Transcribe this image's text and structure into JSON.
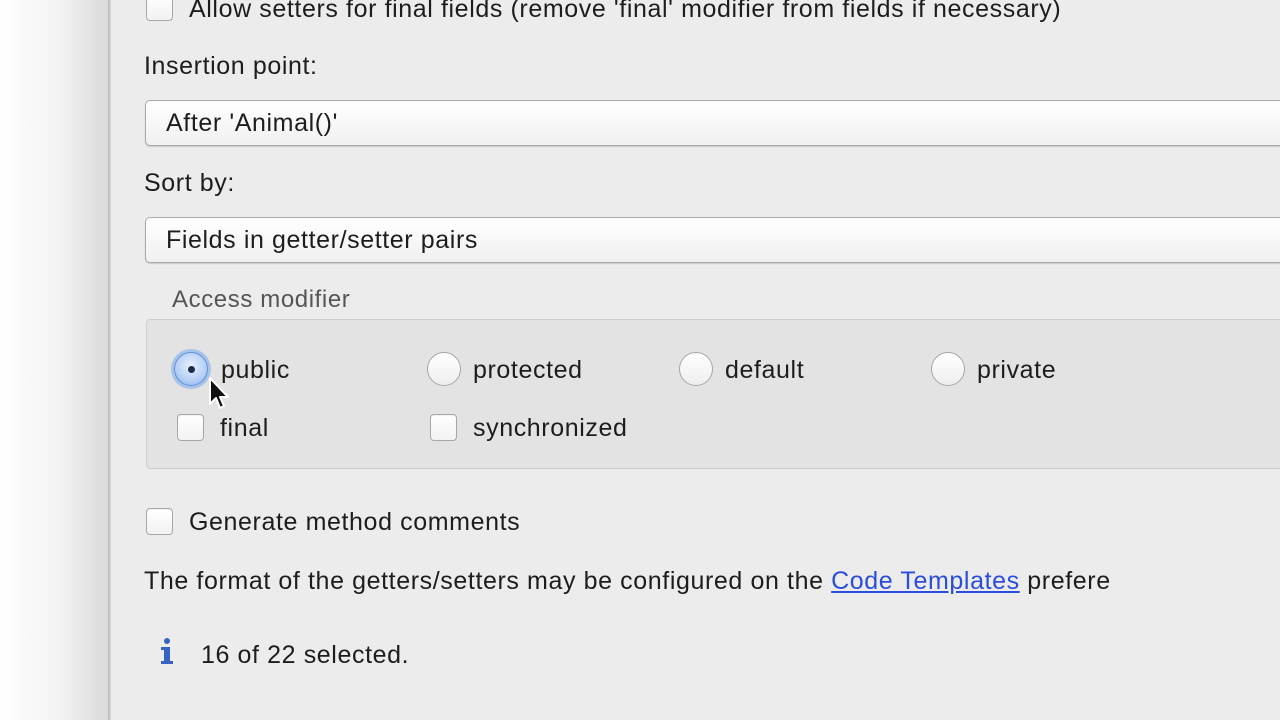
{
  "options": {
    "allow_setters_final": {
      "label": "Allow setters for final fields (remove 'final' modifier from fields if necessary)",
      "checked": false
    },
    "generate_comments": {
      "label": "Generate method comments",
      "checked": false
    }
  },
  "insertion_point": {
    "label": "Insertion point:",
    "value": "After 'Animal()'"
  },
  "sort_by": {
    "label": "Sort by:",
    "value": "Fields in getter/setter pairs"
  },
  "access_modifier": {
    "title": "Access modifier",
    "radios": [
      {
        "label": "public",
        "checked": true
      },
      {
        "label": "protected",
        "checked": false
      },
      {
        "label": "default",
        "checked": false
      },
      {
        "label": "private",
        "checked": false
      }
    ],
    "checkboxes": [
      {
        "label": "final",
        "checked": false
      },
      {
        "label": "synchronized",
        "checked": false
      }
    ]
  },
  "footer": {
    "format_text_before": "The format of the getters/setters may be configured on the",
    "link_text": "Code Templates",
    "format_text_after": "prefere",
    "info_icon": "info-icon",
    "status": "16 of 22 selected."
  },
  "colors": {
    "link": "#2a4ddb",
    "radio_selected": "#86adec",
    "info_icon": "#3463c5"
  }
}
